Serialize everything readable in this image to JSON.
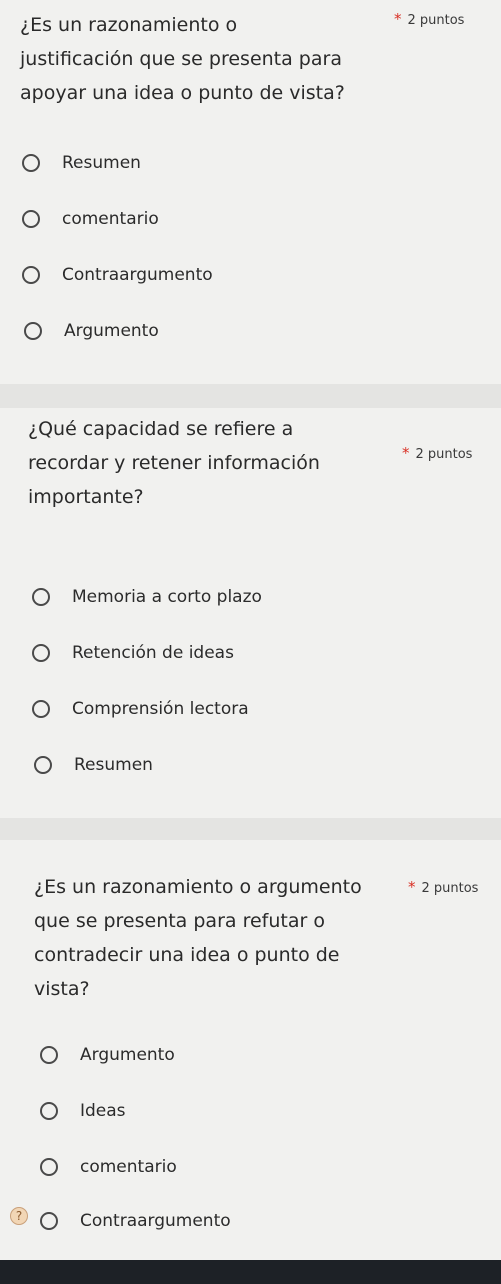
{
  "questions": [
    {
      "title": "¿Es un razonamiento o\njustificación que se presenta para\napoyar una idea o punto de vista?",
      "points": "2 puntos",
      "options": [
        "Resumen",
        "comentario",
        "Contraargumento",
        "Argumento"
      ]
    },
    {
      "title": "¿Qué capacidad se refiere a\nrecordar y retener información\nimportante?",
      "points": "2 puntos",
      "options": [
        "Memoria a corto plazo",
        "Retención de ideas",
        "Comprensión lectora",
        "Resumen"
      ]
    },
    {
      "title": "¿Es un razonamiento o argumento\nque se presenta para refutar o\ncontradecir una idea o punto de\nvista?",
      "points": "2 puntos",
      "options": [
        "Argumento",
        "Ideas",
        "comentario",
        "Contraargumento"
      ]
    }
  ],
  "required_marker": "*",
  "icons": {
    "radio": "radio-unchecked-icon",
    "help": "help-icon"
  },
  "colors": {
    "required": "#d93025",
    "card_background": "#f1f1ef",
    "page_background": "#e4e4e2"
  }
}
